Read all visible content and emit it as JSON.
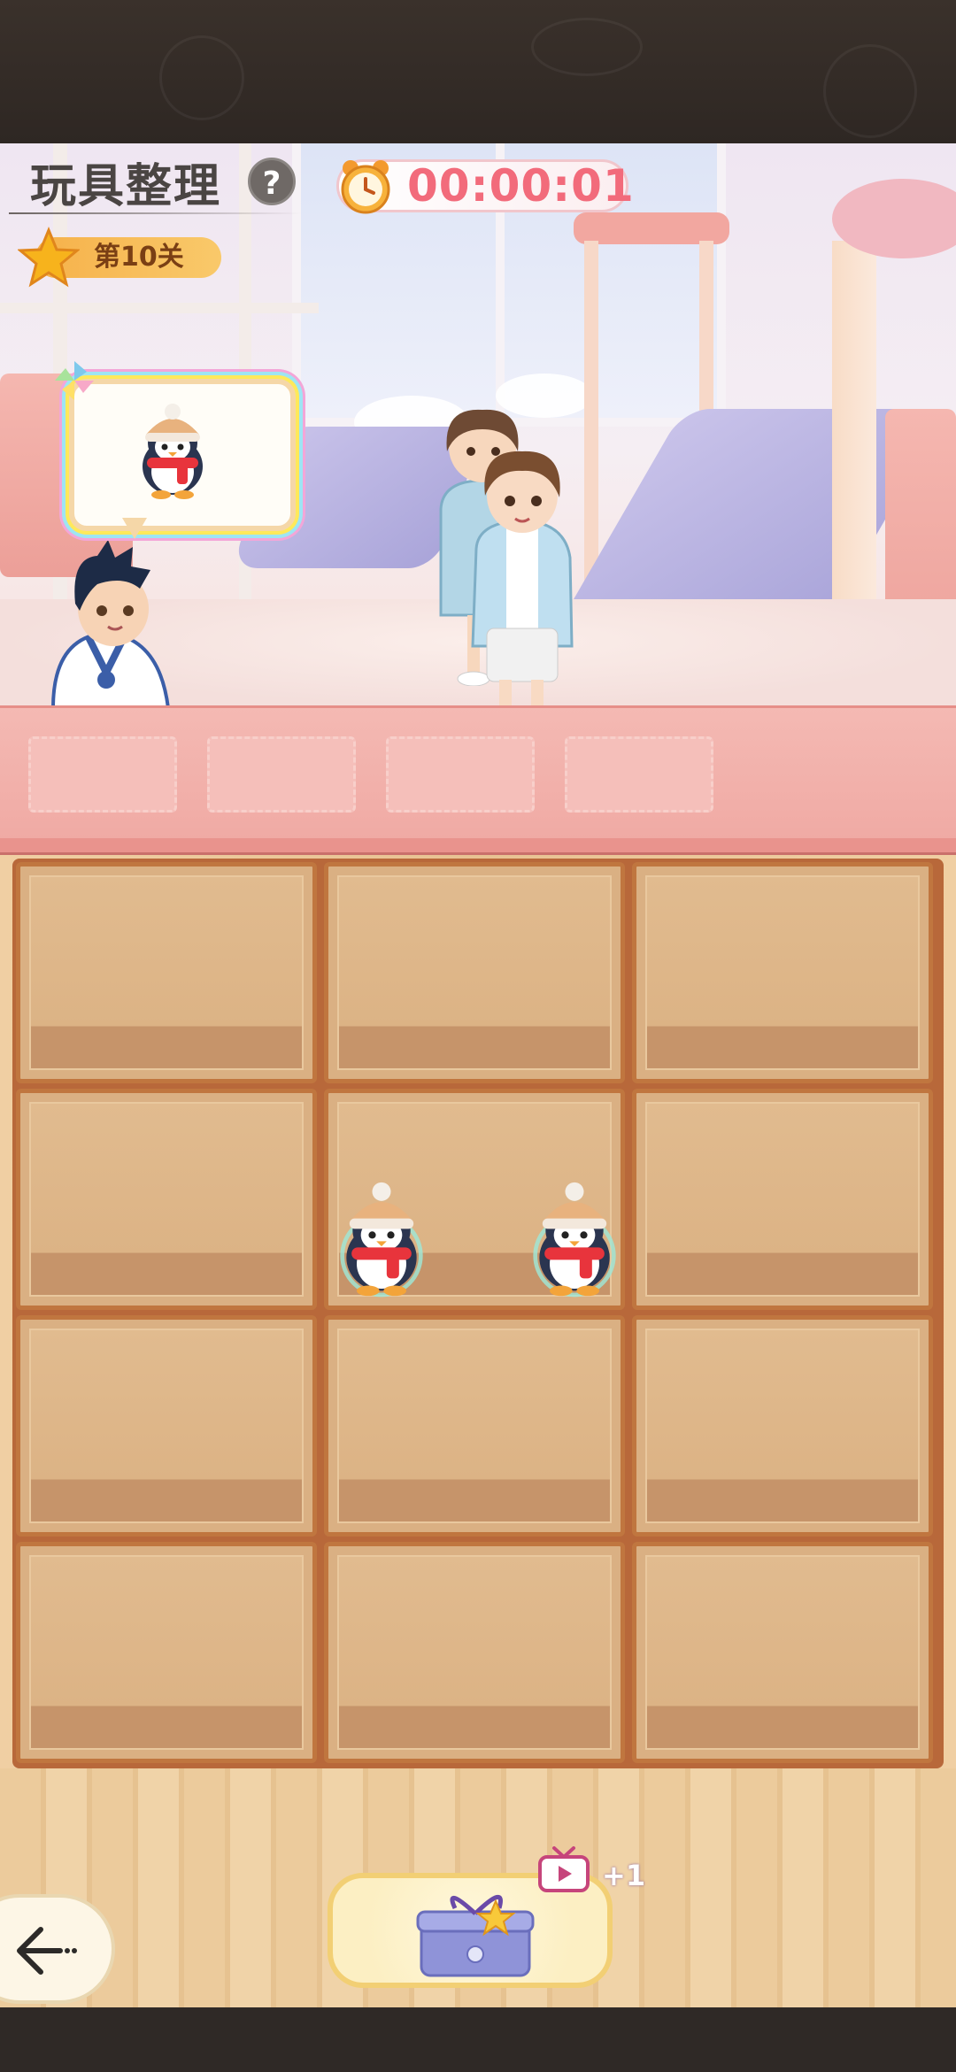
{
  "header": {
    "title": "玩具整理",
    "help_label": "?",
    "timer": "00:00:01",
    "level": "第10关"
  },
  "icons": {
    "help": "question-mark-icon",
    "timer": "alarm-clock-icon",
    "level": "star-icon",
    "target": "penguin-toy",
    "back": "arrow-left-icon",
    "gift": "gift-box-icon",
    "video": "tv-ad-icon"
  },
  "target_bubble": {
    "item": "penguin-toy"
  },
  "tray": {
    "slot_count": 4,
    "filled": []
  },
  "board": {
    "rows": 4,
    "cols": 3,
    "cells": [
      [
        [],
        [],
        []
      ],
      [
        [],
        [
          "penguin-toy",
          "penguin-toy"
        ],
        []
      ],
      [
        [],
        [],
        []
      ],
      [
        [],
        [],
        []
      ]
    ]
  },
  "bottom": {
    "reward_label": "+1"
  },
  "colors": {
    "timer_text": "#f26b7b",
    "level_badge": "#f6b14a",
    "shelf_wood": "#c0763f",
    "tray": "#f0aaa4"
  }
}
